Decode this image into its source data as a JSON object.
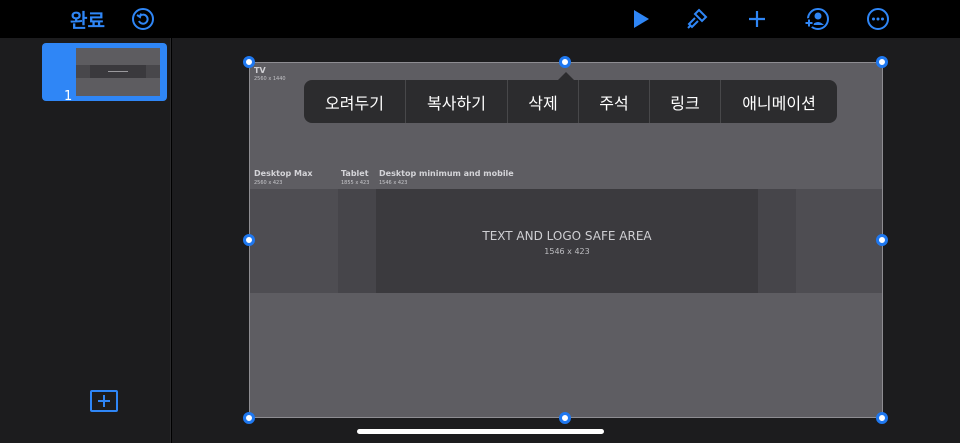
{
  "toolbar": {
    "done_label": "완료",
    "icons": [
      "undo-icon",
      "play-icon",
      "paintbrush-icon",
      "add-icon",
      "collaborate-icon",
      "more-icon"
    ],
    "accent": "#2f86f6"
  },
  "sidebar": {
    "slides": [
      {
        "number": "1",
        "selected": true
      }
    ],
    "add_icon": "add-slide-icon"
  },
  "slide": {
    "tv_label": "TV",
    "tv_dim": "2560 x 1440",
    "desktop_max_label": "Desktop Max",
    "desktop_max_dim": "2560 x 423",
    "tablet_label": "Tablet",
    "tablet_dim": "1855 x 423",
    "desktop_min_label": "Desktop minimum and mobile",
    "desktop_min_dim": "1546 x 423",
    "safe_area_label": "TEXT AND LOGO SAFE AREA",
    "safe_area_dim": "1546 x 423"
  },
  "context_menu": {
    "items": [
      "오려두기",
      "복사하기",
      "삭제",
      "주석",
      "링크",
      "애니메이션"
    ]
  }
}
